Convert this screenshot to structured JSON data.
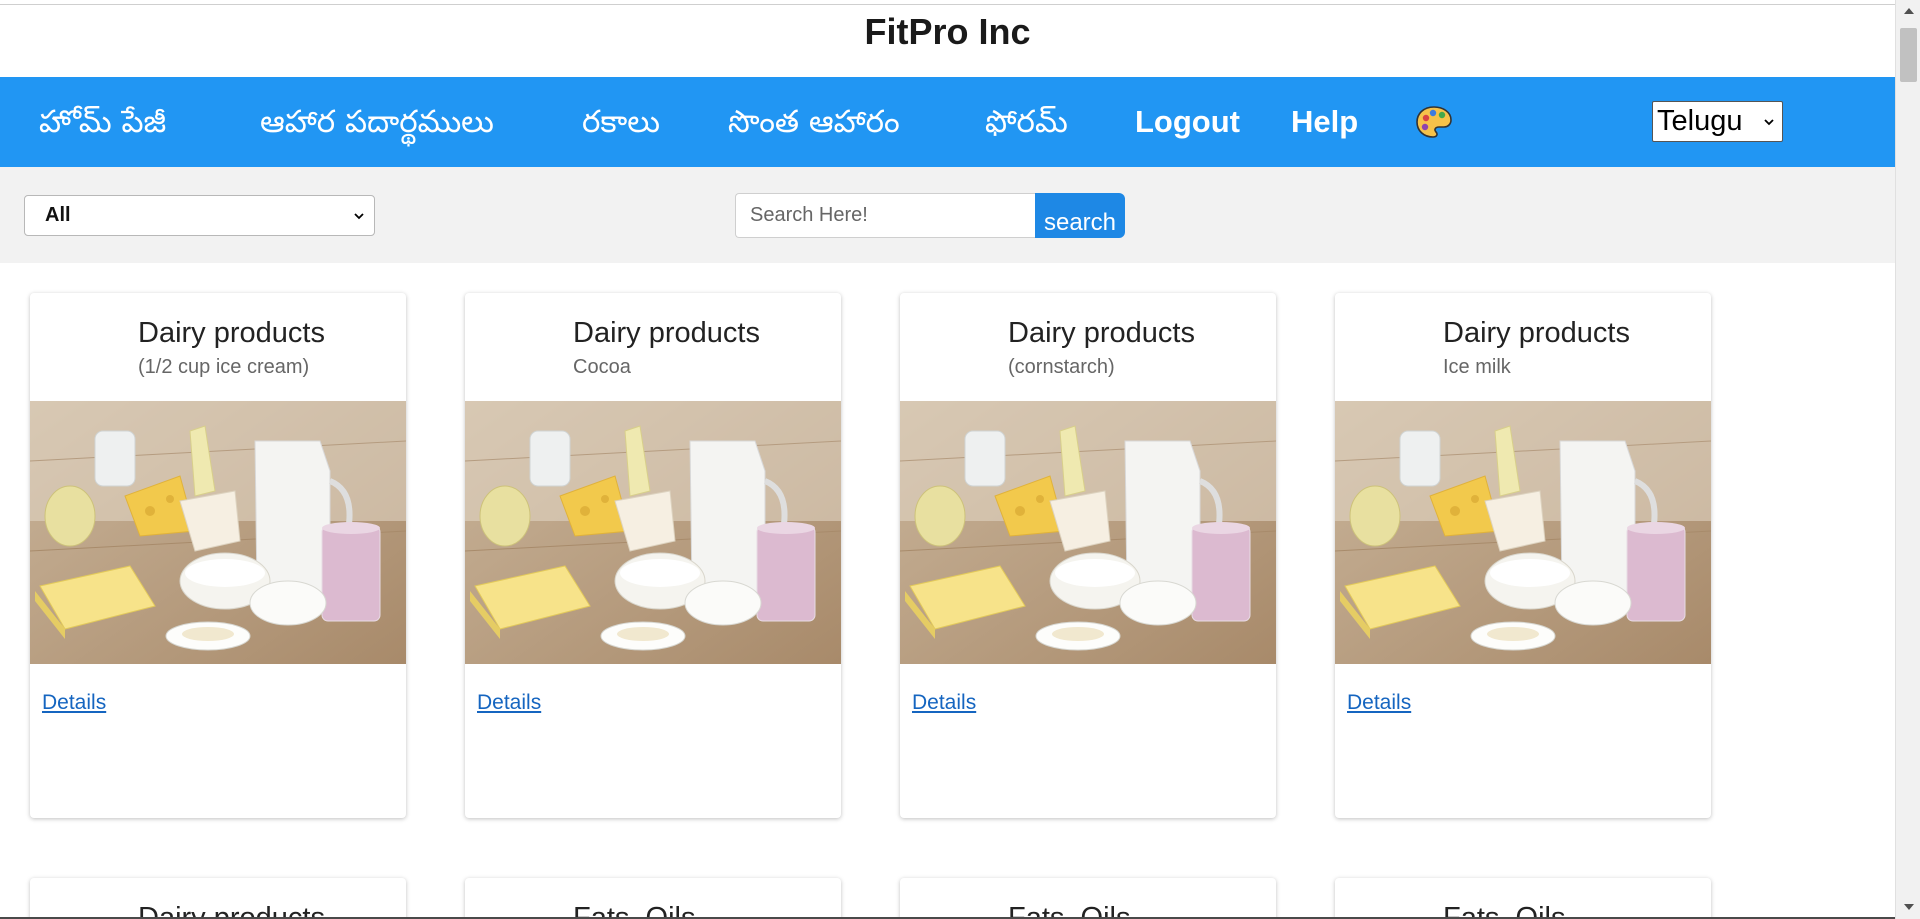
{
  "header": {
    "title": "FitPro Inc"
  },
  "nav": {
    "items": [
      {
        "label": "హోమ్ పేజీ"
      },
      {
        "label": "ఆహార పదార్థములు"
      },
      {
        "label": "రకాలు"
      },
      {
        "label": "సొంత ఆహారం"
      },
      {
        "label": "ఫోరమ్"
      },
      {
        "label": "Logout"
      },
      {
        "label": "Help"
      }
    ],
    "theme_icon": "palette-icon",
    "language": {
      "selected": "Telugu"
    }
  },
  "filters": {
    "category": {
      "selected": "All"
    },
    "search": {
      "placeholder": "Search Here!",
      "button_label": "search"
    }
  },
  "cards": [
    {
      "title": "Dairy products",
      "subtitle": "(1/2 cup ice cream)",
      "link": "Details",
      "image_alt": "dairy-products-photo"
    },
    {
      "title": "Dairy products",
      "subtitle": "Cocoa",
      "link": "Details",
      "image_alt": "dairy-products-photo"
    },
    {
      "title": "Dairy products",
      "subtitle": "(cornstarch)",
      "link": "Details",
      "image_alt": "dairy-products-photo"
    },
    {
      "title": "Dairy products",
      "subtitle": "Ice milk",
      "link": "Details",
      "image_alt": "dairy-products-photo"
    }
  ],
  "next_row": [
    {
      "title": "Dairy products"
    },
    {
      "title": "Fats, Oils"
    },
    {
      "title": "Fats, Oils"
    },
    {
      "title": "Fats, Oils"
    }
  ],
  "colors": {
    "nav_bg": "#2196F3",
    "search_button": "#1e88e5",
    "link": "#1565c0",
    "filter_bg": "#f2f2f2"
  }
}
